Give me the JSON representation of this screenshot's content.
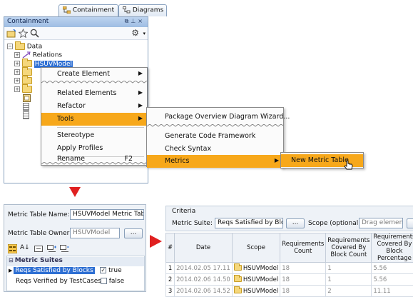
{
  "tabs": [
    {
      "label": "Containment",
      "icon": "containment-tree-icon"
    },
    {
      "label": "Diagrams",
      "icon": "diagrams-icon"
    }
  ],
  "containment": {
    "title": "Containment",
    "header_buttons": [
      "restore-icon",
      "pin-icon",
      "close-icon"
    ],
    "toolbar": {
      "icons": [
        "new-folder-icon",
        "favorite-star-icon",
        "search-icon"
      ],
      "right_icon": "gear-icon"
    },
    "tree": [
      {
        "label": "Data",
        "icon": "folder-icon",
        "expanded": true
      },
      {
        "label": "Relations",
        "icon": "relation-icon"
      },
      {
        "label": "HSUVModel",
        "icon": "folder-icon",
        "selected": true
      },
      {
        "label": "",
        "icon": "folder-icon"
      },
      {
        "label": "",
        "icon": "folder-icon"
      },
      {
        "label": "",
        "icon": "folder-icon"
      },
      {
        "label": "",
        "icon": "package-icon"
      },
      {
        "label": "",
        "icon": "document-icon"
      },
      {
        "label": "",
        "icon": "document-icon"
      }
    ]
  },
  "context_menu": {
    "items": [
      {
        "label": "Create Element",
        "submenu": true
      },
      {
        "label": "Related Elements",
        "submenu": true
      },
      {
        "label": "Refactor",
        "submenu": true
      },
      {
        "label": "Tools",
        "submenu": true,
        "selected": true
      },
      {
        "label": "Stereotype"
      },
      {
        "label": "Apply Profiles"
      },
      {
        "label": "Rename",
        "shortcut": "F2"
      }
    ]
  },
  "tools_menu": {
    "items": [
      {
        "label": "Package Overview Diagram Wizard..."
      },
      {
        "label": "Generate Code Framework"
      },
      {
        "label": "Check Syntax"
      },
      {
        "label": "Metrics",
        "submenu": true,
        "selected": true
      }
    ]
  },
  "metrics_menu": {
    "items": [
      {
        "label": "New Metric Table",
        "selected": true
      }
    ]
  },
  "spec_panel": {
    "name_label": "Metric Table Name:",
    "name_value": "HSUVModel Metric Table",
    "owner_label": "Metric Table Owner:",
    "owner_value": "HSUVModel",
    "owner_button": "...",
    "toolbar_icons": [
      "categorized-view-icon",
      "sort-alpha-icon",
      "collapse-icon",
      "expand-all-icon",
      "collapse-all-icon"
    ],
    "section": "Metric Suites",
    "rows": [
      {
        "label": "Reqs Satisfied by Blocks",
        "checked": true,
        "value": "true",
        "selected": true
      },
      {
        "label": "Reqs Verified by TestCases",
        "checked": false,
        "value": "false",
        "selected": false
      }
    ]
  },
  "metric_table": {
    "criteria_title": "Criteria",
    "suite_label": "Metric Suite:",
    "suite_value": "Reqs Satisfied by Blocks",
    "suite_button": "...",
    "scope_label": "Scope (optional):",
    "scope_placeholder": "Drag elements",
    "scope_button": "...",
    "columns": [
      "#",
      "Date",
      "Scope",
      "Requirements Count",
      "Requirements Covered By Block Count",
      "Requirements Covered By Block Percentage"
    ],
    "rows": [
      {
        "n": "1",
        "date": "2014.02.05 17.11",
        "scope": "HSUVModel",
        "count": "18",
        "covered": "1",
        "pct": "5.56"
      },
      {
        "n": "2",
        "date": "2014.02.06 14.50",
        "scope": "HSUVModel",
        "count": "18",
        "covered": "1",
        "pct": "5.56"
      },
      {
        "n": "3",
        "date": "2014.02.06 14.52",
        "scope": "HSUVModel",
        "count": "18",
        "covered": "2",
        "pct": "11.11"
      }
    ]
  },
  "colors": {
    "menu_highlight": "#f7a81b",
    "arrow": "#e02020",
    "selection": "#2e6fd3",
    "header": "#9ebde3"
  }
}
